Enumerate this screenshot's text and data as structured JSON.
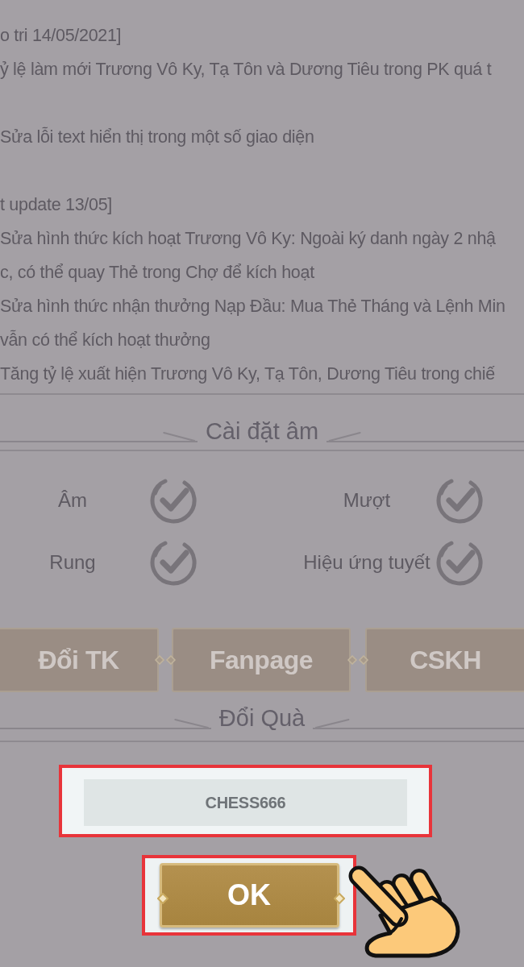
{
  "notes": [
    {
      "lines": [
        "o tri 14/05/2021]",
        "ỷ lệ làm mới Trương Vô Ky, Tạ Tôn và Dương Tiêu trong PK quá t"
      ]
    },
    {
      "lines": [
        "Sửa lỗi text hiển thị trong một số giao diện"
      ]
    },
    {
      "lines": [
        "t update 13/05]",
        "Sửa hình thức kích hoạt Trương Vô Ky: Ngoài ký danh ngày 2 nhậ",
        "c, có thể quay Thẻ trong Chợ để kích hoạt",
        "Sửa hình thức nhận thưởng Nạp Đầu: Mua Thẻ Tháng và Lệnh Min",
        "vẫn có thể kích hoạt thưởng",
        "Tăng tỷ lệ xuất hiện Trương Vô Ky, Tạ Tôn, Dương Tiêu trong chiế"
      ]
    }
  ],
  "sound_settings": {
    "title": "Cài đặt âm",
    "options": [
      {
        "label": "Âm",
        "checked": true
      },
      {
        "label": "Mượt",
        "checked": true
      },
      {
        "label": "Rung",
        "checked": true
      },
      {
        "label": "Hiệu ứng tuyết",
        "checked": true
      }
    ]
  },
  "links": [
    {
      "label": "Đổi TK"
    },
    {
      "label": "Fanpage"
    },
    {
      "label": "CSKH"
    }
  ],
  "redeem": {
    "title": "Đổi Quà",
    "code_field": {
      "value": "CHESS666"
    },
    "submit_button": {
      "label": "OK"
    }
  }
}
